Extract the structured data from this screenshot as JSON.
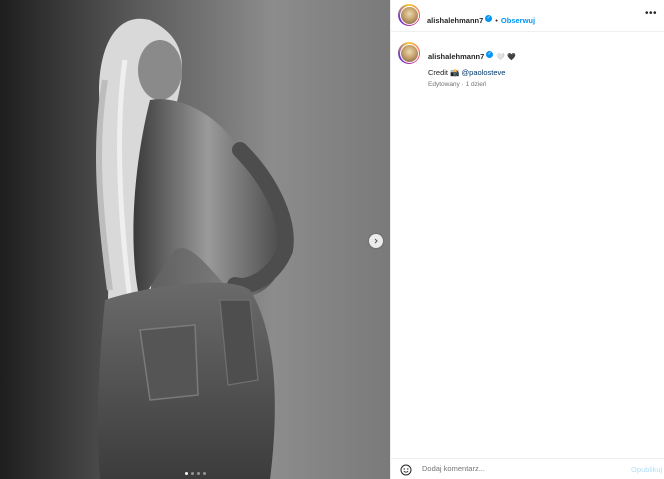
{
  "post": {
    "username": "alishalehmann7",
    "follow_label": "Obserwuj",
    "separator": "•",
    "more_label": "•••",
    "caption": {
      "username": "alishalehmann7",
      "emojis": "🤍 🖤",
      "credit_label": "Credit",
      "credit_emoji": "📸",
      "mention": "@paolosteve",
      "meta": "Edytowany · 1 dzień"
    },
    "carousel": {
      "count": 4,
      "active_index": 0
    },
    "comment": {
      "placeholder": "Dodaj komentarz...",
      "publish_label": "Opublikuj"
    }
  },
  "colors": {
    "accent": "#0095f6",
    "mention": "#00376b",
    "muted": "#737373",
    "publish_disabled": "#b2dffc"
  }
}
